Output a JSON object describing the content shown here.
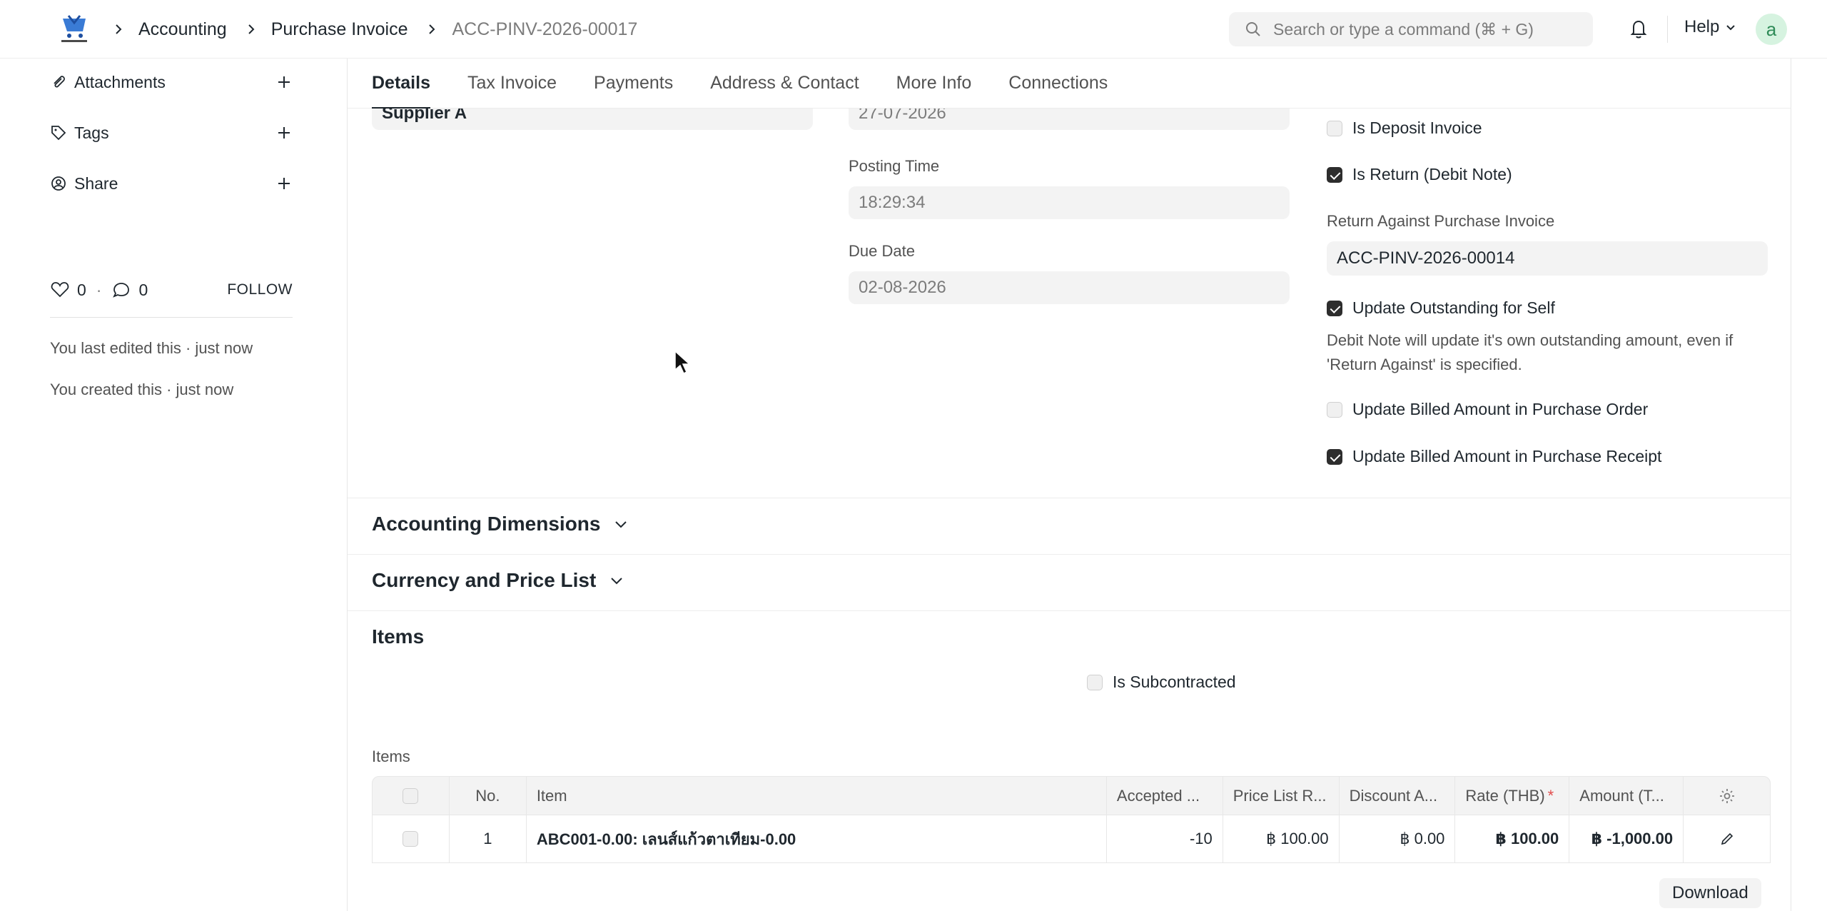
{
  "navbar": {
    "breadcrumbs": [
      "Accounting",
      "Purchase Invoice",
      "ACC-PINV-2026-00017"
    ],
    "search_placeholder": "Search or type a command (⌘ + G)",
    "help_label": "Help",
    "avatar_letter": "a"
  },
  "sidebar": {
    "attachments_label": "Attachments",
    "tags_label": "Tags",
    "share_label": "Share",
    "likes_count": "0",
    "comments_count": "0",
    "follow_label": "FOLLOW",
    "activity": [
      "You last edited this · just now",
      "You created this · just now"
    ]
  },
  "tabs": [
    "Details",
    "Tax Invoice",
    "Payments",
    "Address & Contact",
    "More Info",
    "Connections"
  ],
  "form": {
    "supplier_value": "Supplier A",
    "posting_date_value": "27-07-2026",
    "posting_time_label": "Posting Time",
    "posting_time_value": "18:29:34",
    "due_date_label": "Due Date",
    "due_date_value": "02-08-2026",
    "is_deposit_label": "Is Deposit Invoice",
    "is_deposit_checked": false,
    "is_return_label": "Is Return (Debit Note)",
    "is_return_checked": true,
    "return_against_label": "Return Against Purchase Invoice",
    "return_against_value": "ACC-PINV-2026-00014",
    "update_outstanding_label": "Update Outstanding for Self",
    "update_outstanding_checked": true,
    "update_outstanding_desc": "Debit Note will update it's own outstanding amount, even if 'Return Against' is specified.",
    "update_billed_po_label": "Update Billed Amount in Purchase Order",
    "update_billed_po_checked": false,
    "update_billed_pr_label": "Update Billed Amount in Purchase Receipt",
    "update_billed_pr_checked": true
  },
  "sections": {
    "accounting_dimensions": "Accounting Dimensions",
    "currency_price_list": "Currency and Price List",
    "items": "Items"
  },
  "items_section": {
    "is_subcontracted_label": "Is Subcontracted",
    "is_subcontracted_checked": false,
    "table_label": "Items",
    "columns": [
      "No.",
      "Item",
      "Accepted ...",
      "Price List R...",
      "Discount A...",
      "Rate (THB)",
      "Amount (T..."
    ],
    "rate_required_mark": "*",
    "rows": [
      {
        "no": "1",
        "item": "ABC001-0.00: เลนส์แก้วตาเทียม-0.00",
        "accepted_qty": "-10",
        "price_list_rate": "฿ 100.00",
        "discount_amount": "฿ 0.00",
        "rate": "฿ 100.00",
        "amount": "฿ -1,000.00"
      }
    ],
    "download_label": "Download"
  }
}
